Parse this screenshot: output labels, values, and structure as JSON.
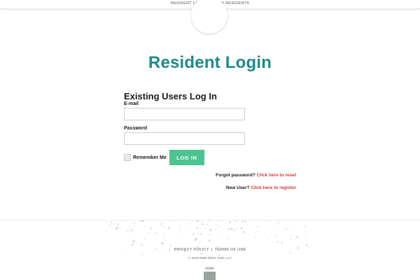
{
  "nav": {
    "resident_login": "RESIDENT LOGIN",
    "separator": "|",
    "new_residents": "NEW RESIDENTS"
  },
  "page": {
    "title": "Resident Login"
  },
  "login_form": {
    "heading": "Existing Users Log In",
    "email_label": "E-mail",
    "email_value": "",
    "password_label": "Password",
    "password_value": "",
    "remember_label": "Remember Me",
    "remember_checked": false,
    "submit_label": "LOG IN"
  },
  "help": {
    "forgot_text": "Forgot password?",
    "forgot_link": "Click here to reset",
    "new_user_text": "New User?",
    "register_link": "Click here to register"
  },
  "footer": {
    "privacy": "PRIVACY POLICY",
    "separator": "|",
    "terms": "TERMS OF USE",
    "copyright": "© 2018 DMB White Tank, LLC",
    "brand_text": "DMB"
  },
  "colors": {
    "title": "#1e8a8a",
    "button": "#4cc390",
    "link": "#d23a3a",
    "pattern": "#c8cdb8"
  },
  "icons": {
    "logo": "circle-logo-icon",
    "checkbox": "checkbox-icon",
    "pattern": "star-pattern-icon"
  }
}
